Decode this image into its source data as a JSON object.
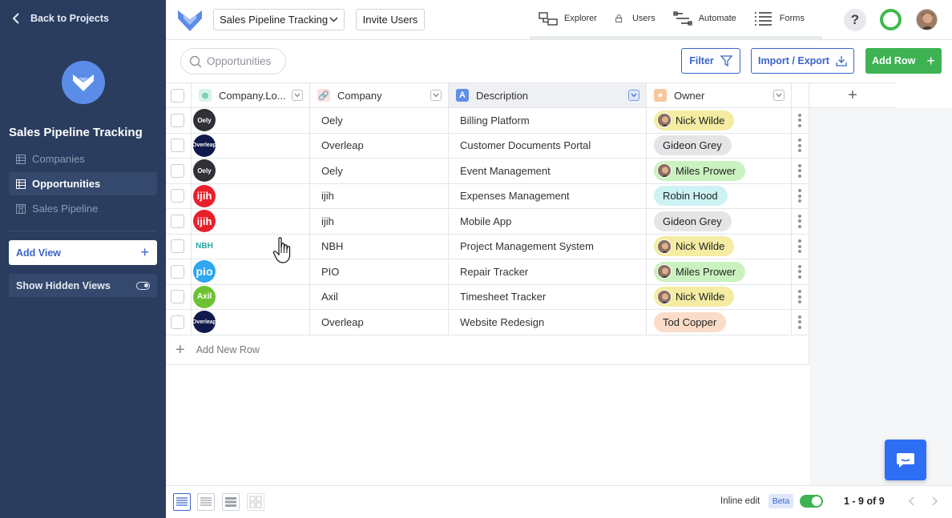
{
  "sidebar": {
    "back_label": "Back to Projects",
    "project_title": "Sales Pipeline Tracking",
    "views": [
      {
        "label": "Companies",
        "active": false
      },
      {
        "label": "Opportunities",
        "active": true
      },
      {
        "label": "Sales Pipeline",
        "active": false
      }
    ],
    "add_view_label": "Add View",
    "show_hidden_label": "Show Hidden Views"
  },
  "topbar": {
    "project_select": "Sales Pipeline Tracking",
    "invite_label": "Invite Users",
    "tabs": [
      {
        "label": "Explorer",
        "icon": "explorer-icon"
      },
      {
        "label": "Users",
        "icon": "lock-icon"
      },
      {
        "label": "Automate",
        "icon": "automate-icon"
      },
      {
        "label": "Forms",
        "icon": "forms-icon"
      }
    ],
    "help_label": "?"
  },
  "toolbar": {
    "search_placeholder": "Opportunities",
    "filter_label": "Filter",
    "import_label": "Import / Export",
    "add_row_label": "Add Row"
  },
  "table": {
    "columns": [
      {
        "label": "Company.Lo...",
        "icon": "link-icon"
      },
      {
        "label": "Company",
        "icon": "link-icon"
      },
      {
        "label": "Description",
        "icon": "text-icon"
      },
      {
        "label": "Owner",
        "icon": "user-icon"
      }
    ],
    "rows": [
      {
        "logo": "Oely",
        "logo_color": "#2f3136",
        "company": "Oely",
        "description": "Billing Platform",
        "owner": "Nick Wilde",
        "owner_color": "#f3eca2",
        "owner_avatar": true
      },
      {
        "logo": "Overleap",
        "logo_color": "#101a4a",
        "company": "Overleap",
        "description": "Customer Documents Portal",
        "owner": "Gideon Grey",
        "owner_color": "#e4e5e7",
        "owner_avatar": false
      },
      {
        "logo": "Oely",
        "logo_color": "#2f3136",
        "company": "Oely",
        "description": "Event Management",
        "owner": "Miles Prower",
        "owner_color": "#caf2c0",
        "owner_avatar": true
      },
      {
        "logo": "ijih",
        "logo_color": "#e8202c",
        "company": "ijih",
        "description": "Expenses Management",
        "owner": "Robin Hood",
        "owner_color": "#cdf2f3",
        "owner_avatar": false
      },
      {
        "logo": "ijih",
        "logo_color": "#e8202c",
        "company": "ijih",
        "description": "Mobile App",
        "owner": "Gideon Grey",
        "owner_color": "#e4e5e7",
        "owner_avatar": false
      },
      {
        "logo": "NBH",
        "logo_color": "#ffffff",
        "company": "NBH",
        "description": "Project Management System",
        "owner": "Nick Wilde",
        "owner_color": "#f3eca2",
        "owner_avatar": true
      },
      {
        "logo": "pio",
        "logo_color": "#2ea6f0",
        "company": "PIO",
        "description": "Repair Tracker",
        "owner": "Miles Prower",
        "owner_color": "#caf2c0",
        "owner_avatar": true
      },
      {
        "logo": "Axil",
        "logo_color": "#6cc233",
        "company": "Axil",
        "description": "Timesheet Tracker",
        "owner": "Nick Wilde",
        "owner_color": "#f3eca2",
        "owner_avatar": true
      },
      {
        "logo": "Overleap",
        "logo_color": "#101a4a",
        "company": "Overleap",
        "description": "Website Redesign",
        "owner": "Tod Copper",
        "owner_color": "#fbdcc8",
        "owner_avatar": false
      }
    ],
    "add_row_label": "Add New Row"
  },
  "footer": {
    "inline_edit_label": "Inline edit",
    "beta_label": "Beta",
    "inline_edit_on": true,
    "pagination": "1 - 9 of 9"
  },
  "colors": {
    "sidebar_bg": "#2a3d5f",
    "accent": "#3b63c9",
    "add_green": "#3db353"
  }
}
